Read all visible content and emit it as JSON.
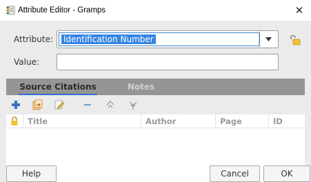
{
  "window": {
    "title": "Attribute Editor - Gramps",
    "close_glyph": "✕"
  },
  "form": {
    "attribute_label": "Attribute:",
    "attribute_value": "Identification Number",
    "value_label": "Value:",
    "value_text": ""
  },
  "tabs": [
    {
      "label": "Source Citations",
      "active": true
    },
    {
      "label": "Notes",
      "active": false
    }
  ],
  "toolbar": {
    "icons": [
      "add-icon",
      "share-existing-icon",
      "edit-icon",
      "remove-icon",
      "move-up-icon",
      "move-down-icon"
    ]
  },
  "table": {
    "columns": [
      "Title",
      "Author",
      "Page",
      "ID"
    ],
    "rows": []
  },
  "buttons": {
    "help": "Help",
    "cancel": "Cancel",
    "ok": "OK"
  },
  "colors": {
    "selection": "#3584e4",
    "tab_bar": "#959595",
    "active_tab_underline": "#2f6fd0",
    "dialog_background": "#ebebeb"
  }
}
